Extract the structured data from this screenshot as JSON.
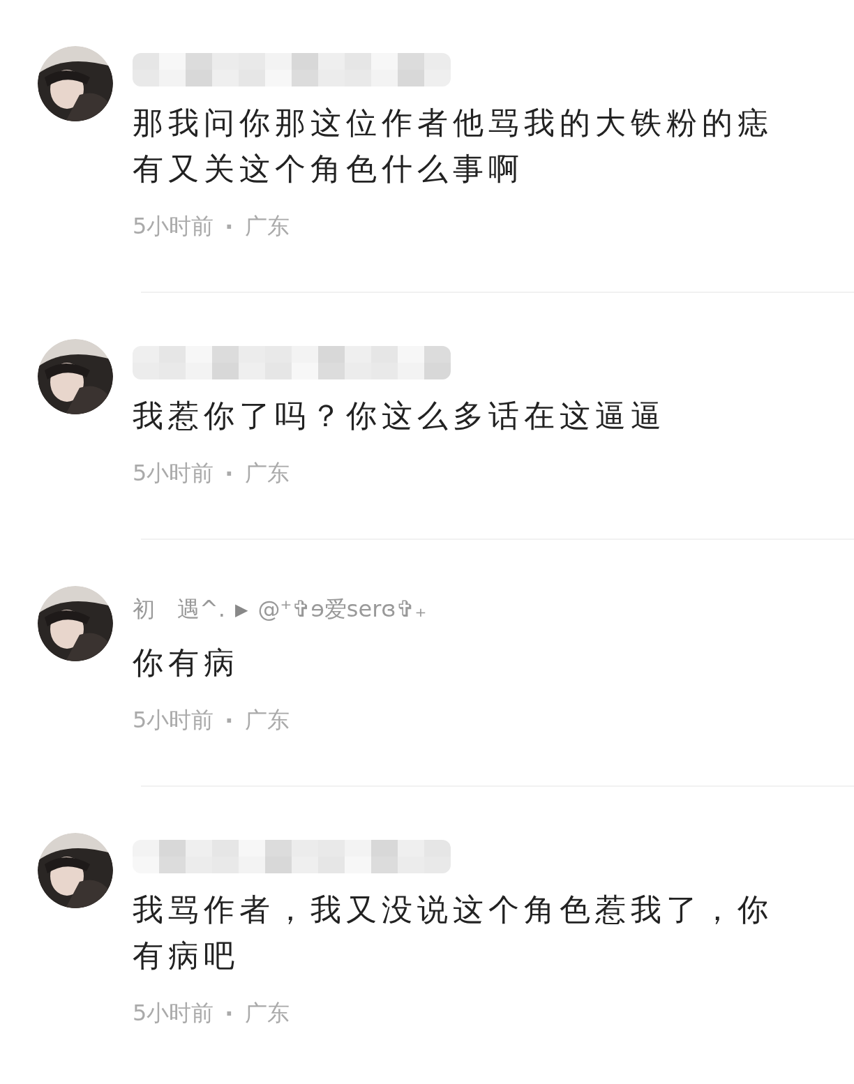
{
  "comments": [
    {
      "name_redacted": true,
      "text": "那我问你那这位作者他骂我的大铁粉的痣有又关这个角色什么事啊",
      "time": "5小时前",
      "separator": "·",
      "location": "广东"
    },
    {
      "name_redacted": true,
      "text": "我惹你了吗？你这么多话在这逼逼",
      "time": "5小时前",
      "separator": "·",
      "location": "广东"
    },
    {
      "name_redacted": false,
      "author": "初　遇^.",
      "arrow": "▶",
      "reply_to": "@⁺✞ɘ爱serɞ✞₊",
      "text": "你有病",
      "time": "5小时前",
      "separator": "·",
      "location": "广东"
    },
    {
      "name_redacted": true,
      "text": "我骂作者，我又没说这个角色惹我了，你有病吧",
      "time": "5小时前",
      "separator": "·",
      "location": "广东"
    }
  ]
}
